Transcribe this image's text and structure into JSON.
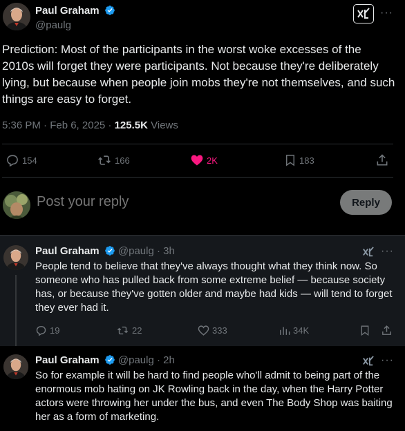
{
  "main_tweet": {
    "author_name": "Paul Graham",
    "author_handle": "@paulg",
    "text": "Prediction: Most of the participants in the worst woke excesses of the 2010s will forget they were participants. Not because they're deliberately lying, but because when people join mobs they're not themselves, and such things are easy to forget.",
    "time": "5:36 PM · Feb 6, 2025 · ",
    "views_count": "125.5K",
    "views_label": " Views",
    "actions": {
      "replies": "154",
      "reposts": "166",
      "likes": "2K",
      "bookmarks": "183"
    },
    "more": "···"
  },
  "reply_composer": {
    "placeholder": "Post your reply",
    "button_label": "Reply"
  },
  "replies": [
    {
      "author_name": "Paul Graham",
      "author_handle": "@paulg",
      "age": "· 3h",
      "text": "People tend to believe that they've always thought what they think now. So someone who has pulled back from some extreme belief — because society has, or because they've gotten older and maybe had kids — will tend to forget they ever had it.",
      "actions": {
        "replies": "19",
        "reposts": "22",
        "likes": "333",
        "views": "34K"
      }
    },
    {
      "author_name": "Paul Graham",
      "author_handle": "@paulg",
      "age": "· 2h",
      "text": "So for example it will be hard to find people who'll admit to being part of the enormous mob hating on JK Rowling back in the day, when the Harry Potter actors were throwing her under the bus, and even The Body Shop was baiting her as a form of marketing."
    }
  ],
  "colors": {
    "background": "#000000",
    "reply_background": "#15181c",
    "text": "#e7e9ea",
    "muted": "#71767b",
    "verified": "#1d9bf0",
    "like": "#f91880"
  }
}
